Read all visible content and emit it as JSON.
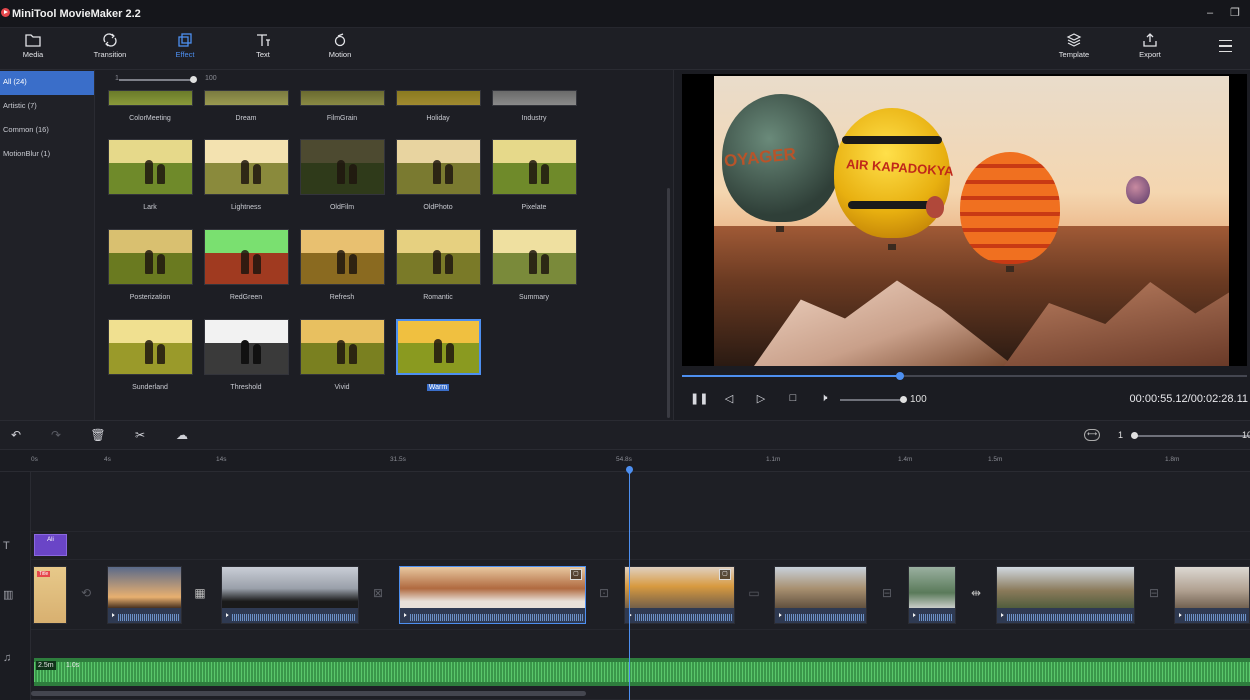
{
  "app": {
    "title": "MiniTool MovieMaker 2.2"
  },
  "toolbar": {
    "items": [
      {
        "label": "Media",
        "icon": "folder-icon"
      },
      {
        "label": "Transition",
        "icon": "transition-icon"
      },
      {
        "label": "Effect",
        "icon": "effect-icon",
        "active": true
      },
      {
        "label": "Text",
        "icon": "text-icon"
      },
      {
        "label": "Motion",
        "icon": "motion-icon"
      }
    ],
    "right": [
      {
        "label": "Template",
        "icon": "template-icon"
      },
      {
        "label": "Export",
        "icon": "export-icon"
      }
    ]
  },
  "categories": [
    {
      "label": "All (24)",
      "selected": true
    },
    {
      "label": "Artistic (7)"
    },
    {
      "label": "Common (16)"
    },
    {
      "label": "MotionBlur (1)"
    }
  ],
  "effects": {
    "size_min": "1",
    "size_max": "100",
    "row0": [
      "ColorMeeting",
      "Dream",
      "FilmGrain",
      "Holiday",
      "Industry"
    ],
    "row1": [
      "Lark",
      "Lightness",
      "OldFilm",
      "OldPhoto",
      "Pixelate"
    ],
    "row2": [
      "Posterization",
      "RedGreen",
      "Refresh",
      "Romantic",
      "Summary"
    ],
    "row3": [
      "Sunderland",
      "Threshold",
      "Vivid",
      "Warm"
    ],
    "selected": "Warm"
  },
  "preview": {
    "balloon_texts": [
      "OYAGER",
      "AIR KAPADOKYA"
    ]
  },
  "player": {
    "progress": 0.39,
    "volume": "100",
    "time": "00:00:55.12/00:02:28.11"
  },
  "timeline": {
    "zoom": "1",
    "zoom_max": "10",
    "ticks": [
      "0s",
      "4s",
      "14s",
      "31.5s",
      "54.8s",
      "1.1m",
      "1.4m",
      "1.5m",
      "1.8m"
    ],
    "text_clip": "Ali",
    "music_duration": "2.5m",
    "music_fade": "1.0s",
    "first_clip_badge": "Title"
  },
  "colors": {
    "accent": "#4d8ff0",
    "selection": "#3a6ec9",
    "music": "#2e7d3d",
    "text_clip": "#6a45c7"
  }
}
